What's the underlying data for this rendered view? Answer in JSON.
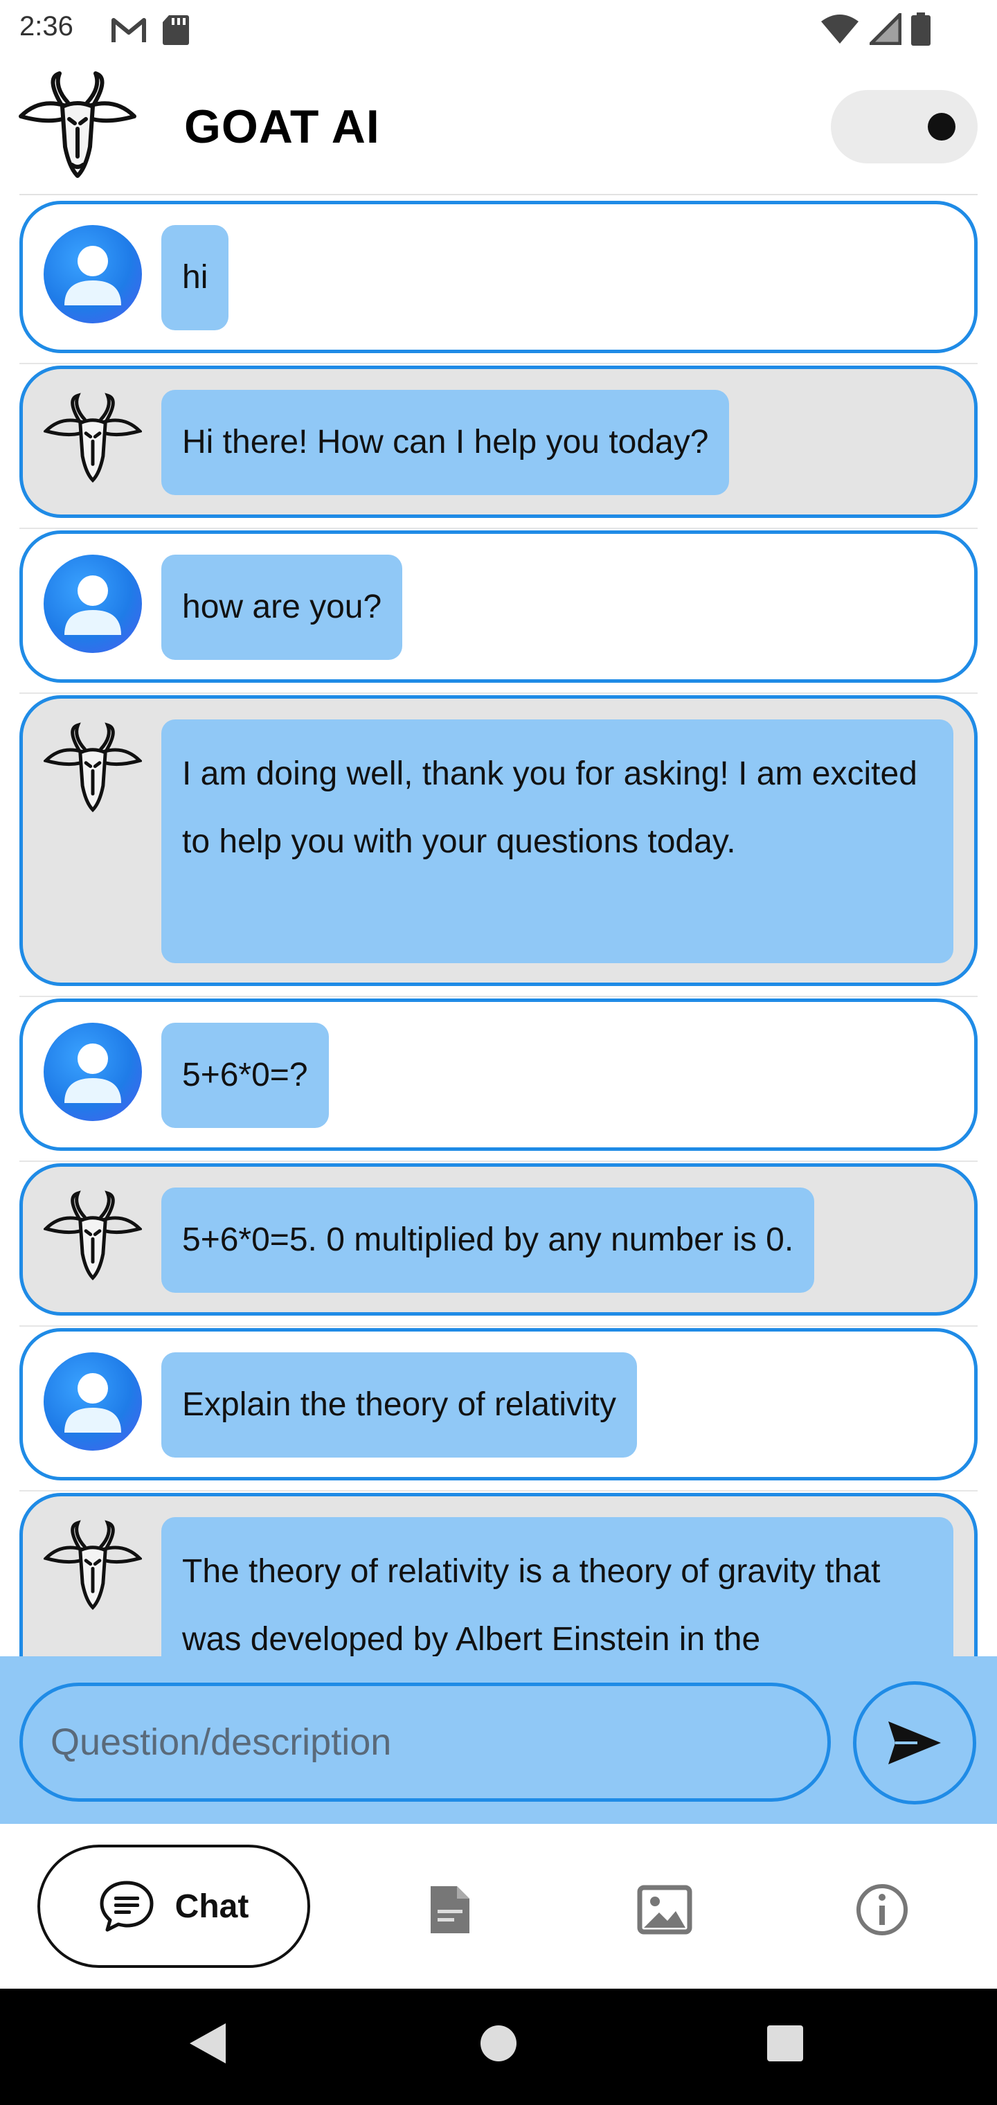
{
  "status_bar": {
    "time": "2:36",
    "left_icons": [
      "gmail-icon",
      "sd-card-icon"
    ],
    "right_icons": [
      "wifi-icon",
      "signal-icon",
      "battery-icon"
    ]
  },
  "header": {
    "title": "GOAT AI",
    "logo": "goat-logo",
    "theme_toggle": "dark-mode-toggle"
  },
  "messages": [
    {
      "role": "user",
      "text": "hi"
    },
    {
      "role": "bot",
      "text": "Hi there! How can I help you today?"
    },
    {
      "role": "user",
      "text": "how are you?"
    },
    {
      "role": "bot",
      "text": "I am doing well, thank you for asking! I am excited to help you with your questions today."
    },
    {
      "role": "user",
      "text": "5+6*0=?"
    },
    {
      "role": "bot",
      "text": "5+6*0=5. 0 multiplied by any number is 0."
    },
    {
      "role": "user",
      "text": "Explain the theory of relativity"
    },
    {
      "role": "bot",
      "text": "The theory of relativity is a theory of gravity that was developed by Albert Einstein in the"
    }
  ],
  "input": {
    "placeholder": "Question/description",
    "value": ""
  },
  "bottom_nav": {
    "chat_label": "Chat",
    "items": [
      "chat-icon",
      "document-icon",
      "image-icon",
      "info-icon"
    ]
  },
  "colors": {
    "accent": "#1f8be6",
    "bubble": "#90c8f6",
    "bot_row": "#e4e4e4"
  }
}
